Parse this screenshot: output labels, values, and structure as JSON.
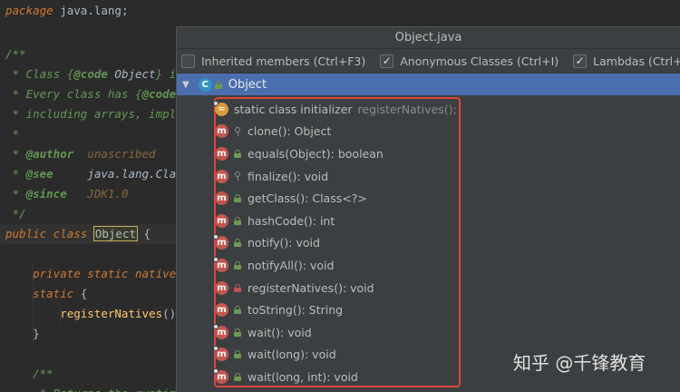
{
  "editor": {
    "lines": [
      {
        "id": "l1",
        "parts": [
          {
            "cls": "kw",
            "t": "package"
          },
          {
            "cls": "plain",
            "t": " java.lang;"
          }
        ]
      },
      {
        "id": "l2",
        "parts": [
          {
            "cls": "doc",
            "t": "/**"
          }
        ]
      },
      {
        "id": "l3",
        "parts": [
          {
            "cls": "doc",
            "t": " * Class {"
          },
          {
            "cls": "doc-tag",
            "t": "@code"
          },
          {
            "cls": "doc-link",
            "t": " Object"
          },
          {
            "cls": "doc",
            "t": "} i"
          }
        ]
      },
      {
        "id": "l4",
        "parts": [
          {
            "cls": "doc",
            "t": " * Every class has {"
          },
          {
            "cls": "doc-tag",
            "t": "@code"
          }
        ]
      },
      {
        "id": "l5",
        "parts": [
          {
            "cls": "doc",
            "t": " * including arrays, impl"
          }
        ]
      },
      {
        "id": "l6",
        "parts": [
          {
            "cls": "doc",
            "t": " *"
          }
        ]
      },
      {
        "id": "l7",
        "parts": [
          {
            "cls": "doc",
            "t": " * "
          },
          {
            "cls": "doc-tag",
            "t": "@author"
          },
          {
            "cls": "doc-val",
            "t": "  unascribed"
          }
        ]
      },
      {
        "id": "l8",
        "parts": [
          {
            "cls": "doc",
            "t": " * "
          },
          {
            "cls": "doc-tag",
            "t": "@see"
          },
          {
            "cls": "doc-link",
            "t": "     java.lang.Cla"
          }
        ]
      },
      {
        "id": "l9",
        "parts": [
          {
            "cls": "doc",
            "t": " * "
          },
          {
            "cls": "doc-tag",
            "t": "@since"
          },
          {
            "cls": "doc-val",
            "t": "   JDK1.0"
          }
        ]
      },
      {
        "id": "l10",
        "parts": [
          {
            "cls": "doc",
            "t": " */"
          }
        ]
      },
      {
        "id": "l11",
        "parts": [
          {
            "cls": "kw",
            "t": "public class "
          },
          {
            "cls": "highlight",
            "t": "Object"
          },
          {
            "cls": "plain",
            "t": " {"
          }
        ]
      },
      {
        "id": "l12",
        "parts": [
          {
            "cls": "plain",
            "t": ""
          }
        ]
      },
      {
        "id": "l13",
        "parts": [
          {
            "cls": "kw",
            "t": "    private static native"
          }
        ]
      },
      {
        "id": "l14",
        "parts": [
          {
            "cls": "kw",
            "t": "    static"
          },
          {
            "cls": "plain",
            "t": " {"
          }
        ]
      },
      {
        "id": "l15",
        "parts": [
          {
            "cls": "fn",
            "t": "        registerNatives"
          },
          {
            "cls": "plain",
            "t": "()"
          }
        ]
      },
      {
        "id": "l16",
        "parts": [
          {
            "cls": "plain",
            "t": "    }"
          }
        ]
      },
      {
        "id": "l17",
        "parts": [
          {
            "cls": "plain",
            "t": ""
          }
        ]
      },
      {
        "id": "l18",
        "parts": [
          {
            "cls": "doc",
            "t": "    /**"
          }
        ]
      },
      {
        "id": "l19",
        "parts": [
          {
            "cls": "doc",
            "t": "     * Returns the runtim"
          }
        ]
      }
    ]
  },
  "popup": {
    "title": "Object.java",
    "options": [
      {
        "label": "Inherited members (Ctrl+F3)",
        "checked": false
      },
      {
        "label": "Anonymous Classes (Ctrl+I)",
        "checked": true
      },
      {
        "label": "Lambdas (Ctrl+L)",
        "checked": true
      }
    ],
    "root": {
      "icon": "C",
      "label": "Object"
    },
    "members": [
      {
        "icon": "=",
        "kind": "static-init",
        "access": "none",
        "label": "static class initializer",
        "sub": "registerNatives();"
      },
      {
        "icon": "m",
        "kind": "method",
        "access": "protected",
        "label": "clone(): Object",
        "sub": ""
      },
      {
        "icon": "m",
        "kind": "method",
        "access": "public",
        "label": "equals(Object): boolean",
        "sub": ""
      },
      {
        "icon": "m",
        "kind": "method",
        "access": "protected",
        "label": "finalize(): void",
        "sub": ""
      },
      {
        "icon": "m",
        "kind": "method",
        "access": "public",
        "label": "getClass(): Class<?>",
        "sub": ""
      },
      {
        "icon": "m",
        "kind": "method",
        "access": "public",
        "label": "hashCode(): int",
        "sub": ""
      },
      {
        "icon": "m",
        "kind": "method",
        "access": "public",
        "label": "notify(): void",
        "sub": ""
      },
      {
        "icon": "m",
        "kind": "method",
        "access": "public",
        "label": "notifyAll(): void",
        "sub": ""
      },
      {
        "icon": "m",
        "kind": "method",
        "access": "private",
        "label": "registerNatives(): void",
        "sub": ""
      },
      {
        "icon": "m",
        "kind": "method",
        "access": "public",
        "label": "toString(): String",
        "sub": ""
      },
      {
        "icon": "m",
        "kind": "method",
        "access": "public",
        "label": "wait(): void",
        "sub": ""
      },
      {
        "icon": "m",
        "kind": "method",
        "access": "public",
        "label": "wait(long): void",
        "sub": ""
      },
      {
        "icon": "m",
        "kind": "method",
        "access": "public",
        "label": "wait(long, int): void",
        "sub": ""
      }
    ]
  },
  "watermark": "知乎 @千锋教育",
  "colors": {
    "selection": "#4b6eaf",
    "outline": "#d9453a",
    "method_icon": "#c75450",
    "static_init_icon": "#d99a3a",
    "class_icon": "#3592c4"
  }
}
